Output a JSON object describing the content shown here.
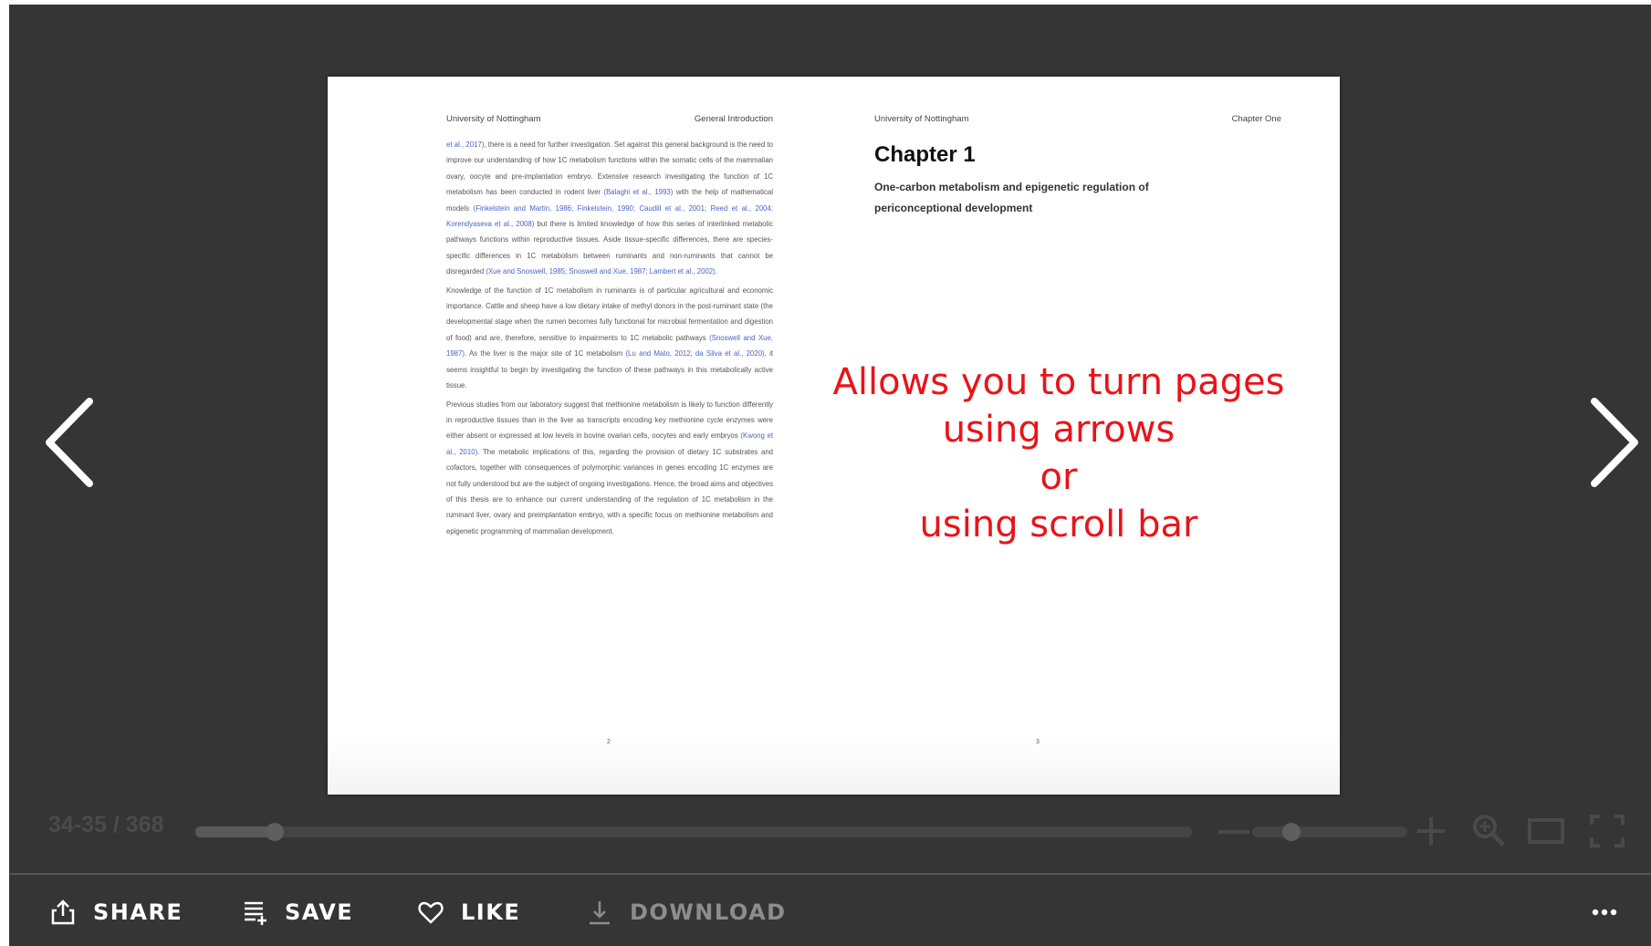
{
  "viewer": {
    "prev_arrow_icon": "chevron-left-icon",
    "next_arrow_icon": "chevron-right-icon"
  },
  "left_page": {
    "header_left": "University of Nottingham",
    "header_right": "General Introduction",
    "paragraphs": [
      [
        {
          "t": "et al., 2017)",
          "ref": true
        },
        {
          "t": ", there is a need for further investigation. Set against this general background is the need to improve our understanding of how 1C metabolism functions within the somatic cells of the mammalian ovary, oocyte and pre-implantation embryo. Extensive research investigating the function of 1C metabolism has been conducted in rodent liver "
        },
        {
          "t": "(Balaghi et al., 1993)",
          "ref": true
        },
        {
          "t": " with the help of mathematical models "
        },
        {
          "t": "(Finkelstein and Martin, 1986; Finkelstein, 1990; Caudill et al., 2001; Reed et al., 2004; Korendyaseva et al., 2008)",
          "ref": true
        },
        {
          "t": " but there is limited knowledge of how this series of interlinked metabolic pathways functions within reproductive tissues. Aside tissue-specific differences, there are species-specific differences in 1C metabolism between ruminants and non-ruminants that cannot be disregarded "
        },
        {
          "t": "(Xue and Snoswell, 1985; Snoswell and Xue, 1987; Lambert et al., 2002)",
          "ref": true
        },
        {
          "t": "."
        }
      ],
      [
        {
          "t": "Knowledge of the function of 1C metabolism in ruminants is of particular agricultural and economic importance. Cattle and sheep have a low dietary intake of methyl donors in the post-ruminant state (the developmental stage when the rumen becomes fully functional for microbial fermentation and digestion of food) and are, therefore, sensitive to impairments to 1C metabolic pathways "
        },
        {
          "t": "(Snoswell and Xue, 1987)",
          "ref": true
        },
        {
          "t": ". As the liver is the major site of 1C metabolism "
        },
        {
          "t": "(Lu and Mato, 2012; da Silva et al., 2020)",
          "ref": true
        },
        {
          "t": ", it seems insightful to begin by investigating the function of these pathways in this metabolically active tissue."
        }
      ],
      [
        {
          "t": "Previous studies from our laboratory suggest that methionine metabolism is likely to function differently in reproductive tissues than in the liver as transcripts encoding key methionine cycle enzymes were either absent or expressed at low levels in bovine ovarian cells, oocytes and early embryos "
        },
        {
          "t": "(Kwong et al., 2010)",
          "ref": true
        },
        {
          "t": ". The metabolic implications of this, regarding the provision of dietary 1C substrates and cofactors, together with consequences of polymorphic variances in genes encoding 1C enzymes are not fully understood but are the subject of ongoing investigations. Hence, the broad aims and objectives of this thesis are to enhance our current understanding of the regulation of 1C metabolism in the ruminant liver, ovary and preimplantation embryo, with a specific focus on methionine metabolism and epigenetic programming of mammalian development."
        }
      ]
    ],
    "page_number": "2"
  },
  "right_page": {
    "header_left": "University of Nottingham",
    "header_right": "Chapter One",
    "chapter_title": "Chapter 1",
    "chapter_subtitle": "One-carbon metabolism and epigenetic regulation of periconceptional development",
    "page_number": "3"
  },
  "annotation": {
    "lines": [
      "Allows you to turn pages",
      "using arrows",
      "or",
      "using scroll bar"
    ],
    "color": "#e8141a"
  },
  "controls": {
    "page_counter": "34-35 / 368",
    "scroll_progress": 0.08,
    "zoom_level": 0.25,
    "icons": [
      "minus-icon",
      "plus-icon",
      "zoom-icon",
      "single-page-icon",
      "fullscreen-icon"
    ]
  },
  "actions": {
    "share_label": "SHARE",
    "save_label": "SAVE",
    "like_label": "LIKE",
    "download_label": "DOWNLOAD",
    "more_icon": "more-icon"
  },
  "colors": {
    "viewer_bg": "#353535",
    "link": "#4a63c8"
  }
}
